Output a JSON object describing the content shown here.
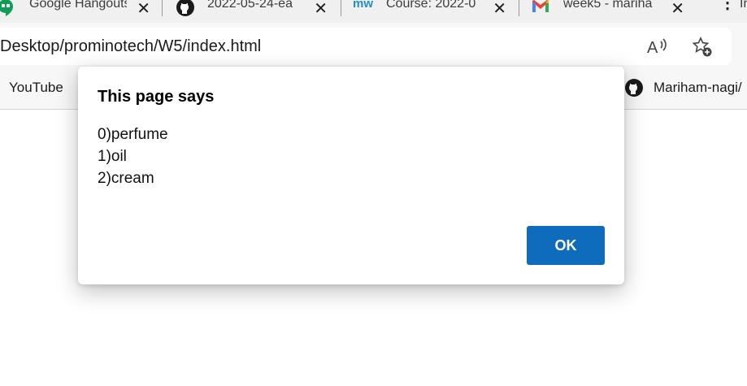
{
  "tabs": [
    {
      "title": "Google Hangouts",
      "icon": "hangouts-icon"
    },
    {
      "title": "2022-05-24-ea",
      "icon": "github-icon"
    },
    {
      "title": "Course: 2022-0",
      "icon": "mw-icon",
      "icon_text": "mw"
    },
    {
      "title": "week5 - mariha",
      "icon": "gmail-icon"
    },
    {
      "title": "In",
      "icon": "more-icon"
    }
  ],
  "tab_close_glyph": "✕",
  "address_bar": {
    "url": "Desktop/prominotech/W5/index.html",
    "read_aloud_icon": "read-aloud-icon",
    "favorite_icon": "add-favorite-icon"
  },
  "bookmarks": {
    "left_label": "YouTube",
    "right_label": "Mariham-nagi/"
  },
  "dialog": {
    "title": "This page says",
    "message_lines": [
      "0)perfume",
      "1)oil",
      "2)cream"
    ],
    "ok_label": "OK"
  },
  "colors": {
    "accent": "#0f6cbd",
    "tab_strip": "#f0f0f0",
    "toolbar": "#f7f7f7"
  }
}
